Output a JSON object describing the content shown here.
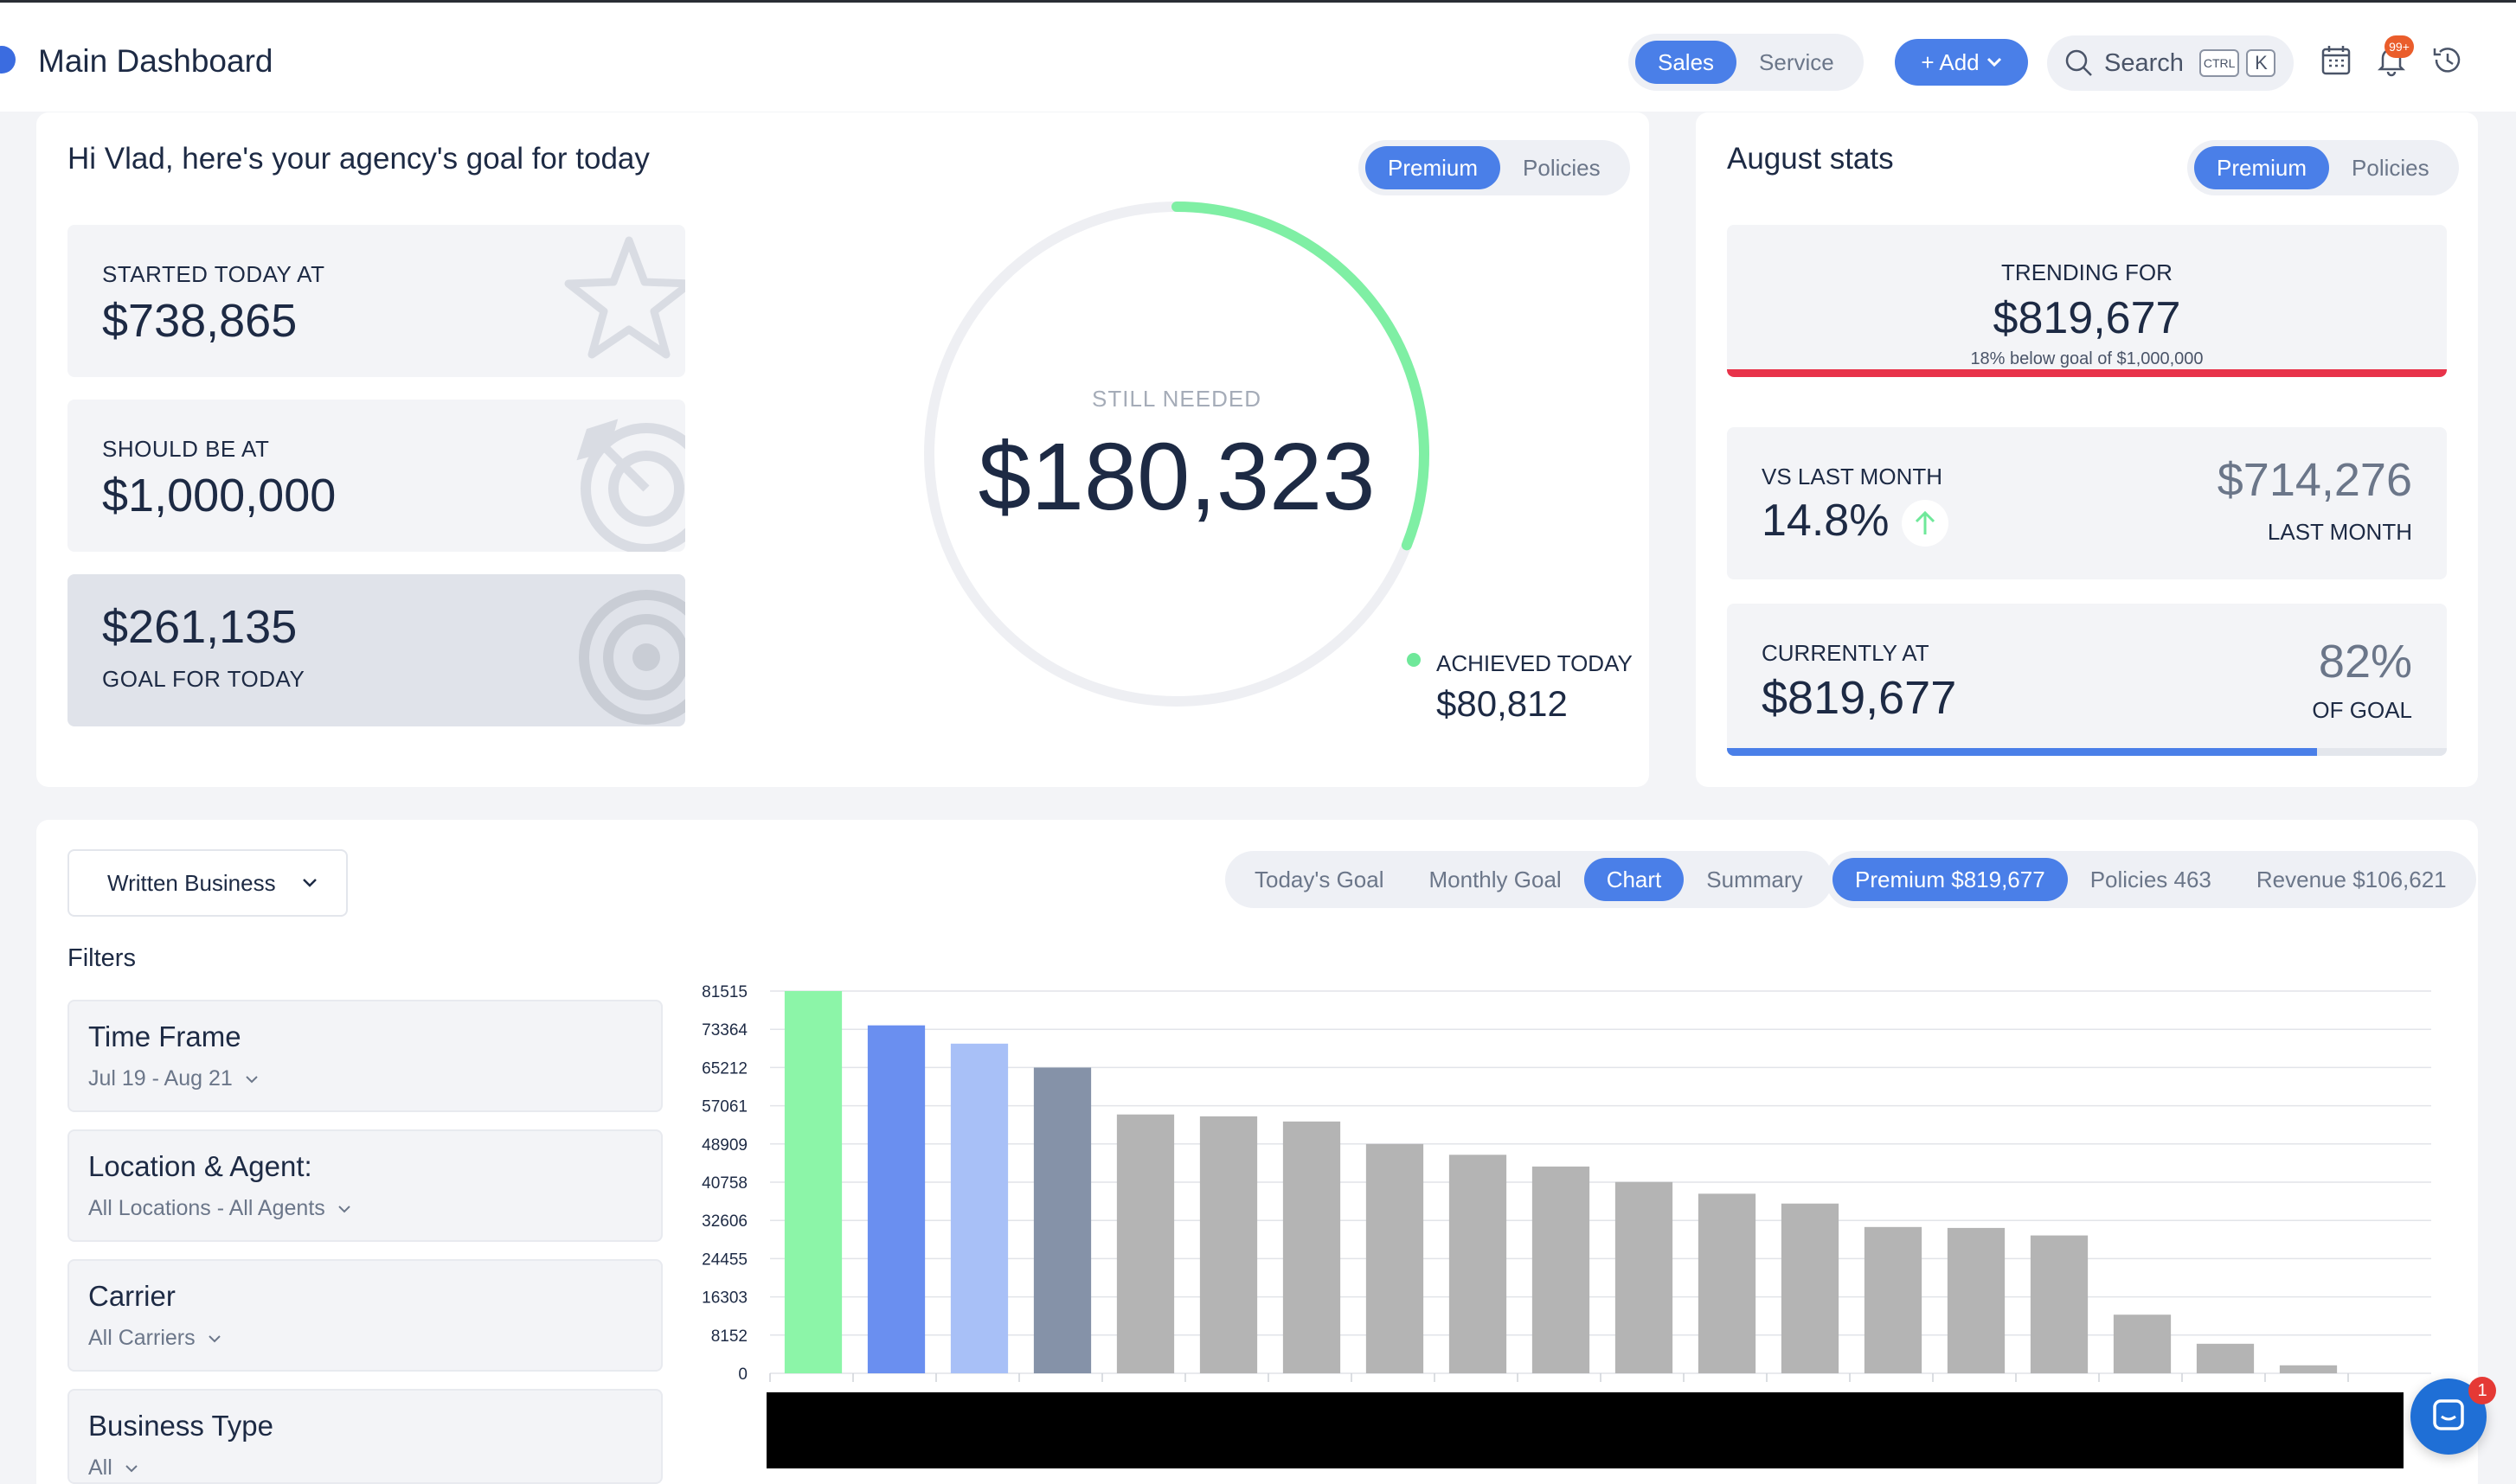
{
  "header": {
    "title": "Main Dashboard",
    "mode_tabs": [
      "Sales",
      "Service"
    ],
    "add_label": "+ Add",
    "search_label": "Search",
    "kbd_ctrl": "CTRL",
    "kbd_k": "K",
    "notification_badge": "99+"
  },
  "goal_card": {
    "greeting": "Hi Vlad, here's your agency's goal for today",
    "toggle": [
      "Premium",
      "Policies"
    ],
    "started_label": "STARTED TODAY AT",
    "started_value": "$738,865",
    "should_label": "SHOULD BE AT",
    "should_value": "$1,000,000",
    "goal_value": "$261,135",
    "goal_label": "GOAL FOR TODAY",
    "still_needed_label": "STILL NEEDED",
    "still_needed_value": "$180,323",
    "achieved_label": "ACHIEVED TODAY",
    "achieved_value": "$80,812",
    "achieved_fraction": 0.31
  },
  "august": {
    "title": "August stats",
    "toggle": [
      "Premium",
      "Policies"
    ],
    "trending_label": "TRENDING FOR",
    "trending_value": "$819,677",
    "trending_note": "18% below goal of $1,000,000",
    "vs_label": "VS LAST MONTH",
    "vs_value": "14.8%",
    "last_month_value": "$714,276",
    "last_month_label": "LAST MONTH",
    "current_label": "CURRENTLY AT",
    "current_value": "$819,677",
    "pct_value": "82%",
    "pct_label": "OF GOAL",
    "progress_fraction": 0.82
  },
  "bottom": {
    "dropdown_label": "Written Business",
    "view_tabs": [
      "Today's Goal",
      "Monthly Goal",
      "Chart",
      "Summary"
    ],
    "metric_tabs": [
      "Premium $819,677",
      "Policies 463",
      "Revenue $106,621"
    ],
    "filters_title": "Filters",
    "filters": [
      {
        "title": "Time Frame",
        "value": "Jul 19 - Aug 21"
      },
      {
        "title": "Location & Agent:",
        "value": "All Locations - All Agents"
      },
      {
        "title": "Carrier",
        "value": "All Carriers"
      },
      {
        "title": "Business Type",
        "value": "All"
      }
    ]
  },
  "colors": {
    "accent": "#4a7fe8",
    "ring_progress": "#7fefa4",
    "trend_bar": "#e8334a"
  },
  "chat": {
    "badge": "1"
  },
  "chart_data": {
    "type": "bar",
    "categories": [
      "",
      "",
      "",
      "",
      "",
      "",
      "",
      "",
      "",
      "",
      "",
      "",
      "",
      "",
      "",
      "",
      "",
      "",
      "",
      ""
    ],
    "values": [
      81515,
      74200,
      70300,
      65200,
      55200,
      54800,
      53700,
      48900,
      46600,
      44100,
      40800,
      38300,
      36200,
      31200,
      31000,
      29400,
      12500,
      6300,
      1700,
      0
    ],
    "bar_colors": [
      "#8cf5a8",
      "#6a8ff0",
      "#a8c0f7",
      "#8592a8",
      "#b4b4b4",
      "#b4b4b4",
      "#b4b4b4",
      "#b4b4b4",
      "#b4b4b4",
      "#b4b4b4",
      "#b4b4b4",
      "#b4b4b4",
      "#b4b4b4",
      "#b4b4b4",
      "#b4b4b4",
      "#b4b4b4",
      "#b4b4b4",
      "#b4b4b4",
      "#b4b4b4",
      "#b4b4b4"
    ],
    "yticks": [
      0,
      8152,
      16303,
      24455,
      32606,
      40758,
      48909,
      57061,
      65212,
      73364,
      81515
    ],
    "ylim": [
      0,
      81515
    ],
    "grid": true,
    "title": "",
    "xlabel": "",
    "ylabel": ""
  }
}
